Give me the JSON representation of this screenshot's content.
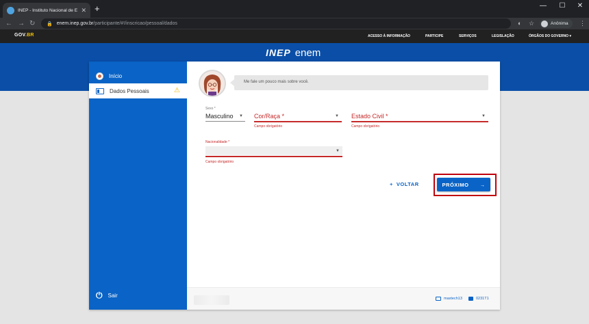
{
  "browser": {
    "tab_title": "INEP - Instituto Nacional de Est...",
    "tab_close": "✕",
    "new_tab": "+",
    "url_host": "enem.inep.gov.br",
    "url_path": "/participante/#!/inscricao/pessoal/dados",
    "profile_label": "Anônima",
    "window_controls": [
      "—",
      "☐",
      "✕"
    ]
  },
  "govbar": {
    "logo_gov": "GOV",
    "logo_br": ".BR",
    "links": [
      "ACESSO À INFORMAÇÃO",
      "PARTICIPE",
      "SERVIÇOS",
      "LEGISLAÇÃO",
      "ÓRGÃOS DO GOVERNO"
    ]
  },
  "brand": {
    "inep": "INEP",
    "enem": "enem"
  },
  "sidebar": {
    "items": [
      {
        "label": "Início",
        "icon": "avatar-icon"
      },
      {
        "label": "Dados Pessoais",
        "icon": "id-card-icon",
        "status": "warning"
      }
    ],
    "logout_label": "Sair"
  },
  "assistant": {
    "message": "Me fale um pouco mais sobre você."
  },
  "form": {
    "sexo": {
      "label": "Sexo *",
      "value": "Masculino"
    },
    "cor_raca": {
      "label": "Cor/Raça *",
      "help": "Campo obrigatório"
    },
    "estado_civil": {
      "label": "Estado Civil *",
      "help": "Campo obrigatório"
    },
    "nacionalidade": {
      "label": "Nacionalidade *",
      "help": "Campo obrigatório"
    }
  },
  "actions": {
    "back_label": "VOLTAR",
    "back_icon": "+",
    "next_label": "PRÓXIMO",
    "next_icon": "→"
  },
  "footer": {
    "machine": "maxtech13",
    "code": "0231T1"
  },
  "colors": {
    "primary": "#0a63c6",
    "header": "#0a4ea7",
    "error": "#c62828",
    "highlight": "#c0000a",
    "warning": "#f2b600"
  }
}
